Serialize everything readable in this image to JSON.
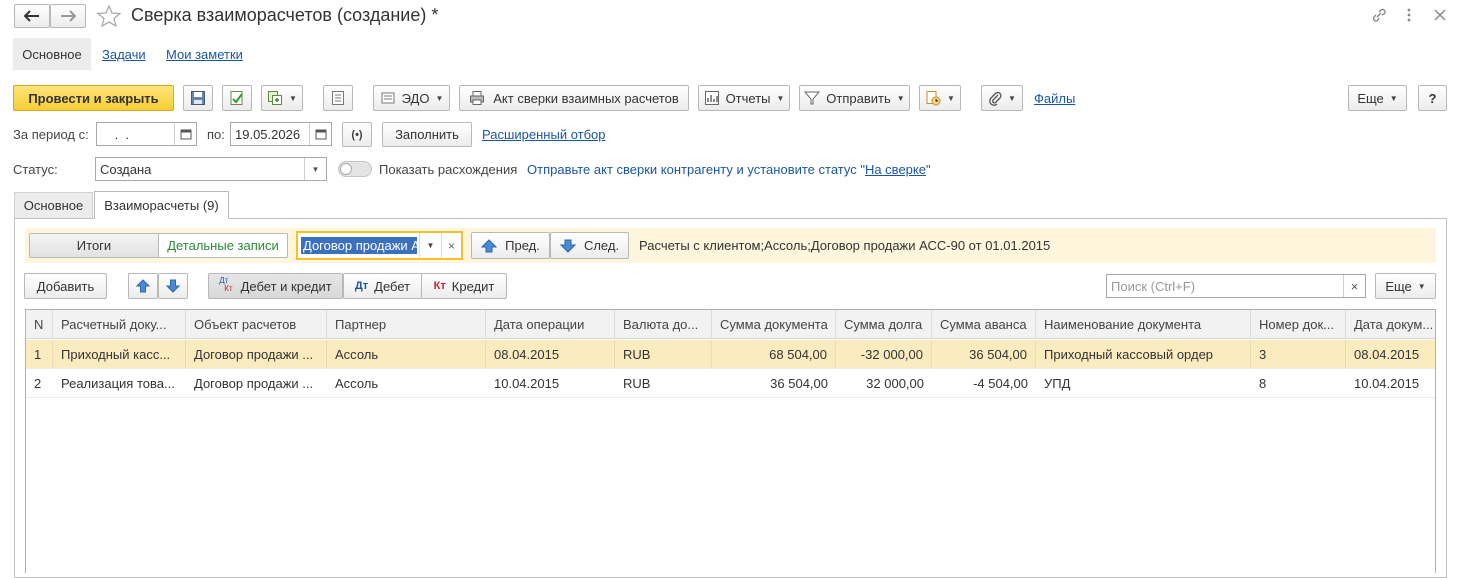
{
  "window": {
    "title": "Сверка взаиморасчетов (создание) *"
  },
  "nav_tabs": [
    {
      "label": "Основное"
    },
    {
      "label": "Задачи"
    },
    {
      "label": "Мои заметки"
    }
  ],
  "toolbar": {
    "post_close": "Провести и закрыть",
    "edo": "ЭДО",
    "act": "Акт сверки взаимных расчетов",
    "reports": "Отчеты",
    "send": "Отправить",
    "files": "Файлы",
    "more": "Еще",
    "help": "?"
  },
  "period": {
    "from_label": "За период с:",
    "from_value": " .  .",
    "to_label": "по:",
    "to_value": "19.05.2026",
    "fill": "Заполнить",
    "ext_filter": "Расширенный отбор"
  },
  "status": {
    "label": "Статус:",
    "value": "Создана",
    "show_diff": "Показать расхождения",
    "hint_text": "Отправьте акт сверки контрагенту и установите статус \"",
    "hint_link": "На сверке",
    "hint_end": "\""
  },
  "form_tabs": [
    {
      "label": "Основное"
    },
    {
      "label": "Взаиморасчеты (9)"
    }
  ],
  "mode": {
    "totals": "Итоги",
    "details": "Детальные записи",
    "contract_value": "Договор продажи А",
    "prev": "Пред.",
    "next": "След.",
    "info": "Расчеты с клиентом;Ассоль;Договор продажи АСС-90 от 01.01.2015"
  },
  "list_toolbar": {
    "add": "Добавить",
    "debit_credit": "Дебет и кредит",
    "debit": "Дебет",
    "credit": "Кредит",
    "dt_abbr": "Дт",
    "kt_abbr": "Кт",
    "search_placeholder": "Поиск (Ctrl+F)",
    "more": "Еще"
  },
  "table": {
    "columns": [
      "N",
      "Расчетный доку...",
      "Объект расчетов",
      "Партнер",
      "Дата операции",
      "Валюта до...",
      "Сумма документа",
      "Сумма долга",
      "Сумма аванса",
      "Наименование документа",
      "Номер док...",
      "Дата докум..."
    ],
    "rows": [
      [
        "1",
        "Приходный касс...",
        "Договор продажи ...",
        "Ассоль",
        "08.04.2015",
        "RUB",
        "68 504,00",
        "-32 000,00",
        "36 504,00",
        "Приходный кассовый ордер",
        "3",
        "08.04.2015"
      ],
      [
        "2",
        "Реализация това...",
        "Договор продажи ...",
        "Ассоль",
        "10.04.2015",
        "RUB",
        "36 504,00",
        "32 000,00",
        "-4 504,00",
        "УПД",
        "8",
        "10.04.2015"
      ]
    ]
  },
  "colors": {
    "accent_yellow": "#fad84a",
    "link": "#1b56a5",
    "selected_row": "#fbecc0",
    "filter_bar": "#fdf6dc",
    "details_text": "#2a8a3a"
  }
}
